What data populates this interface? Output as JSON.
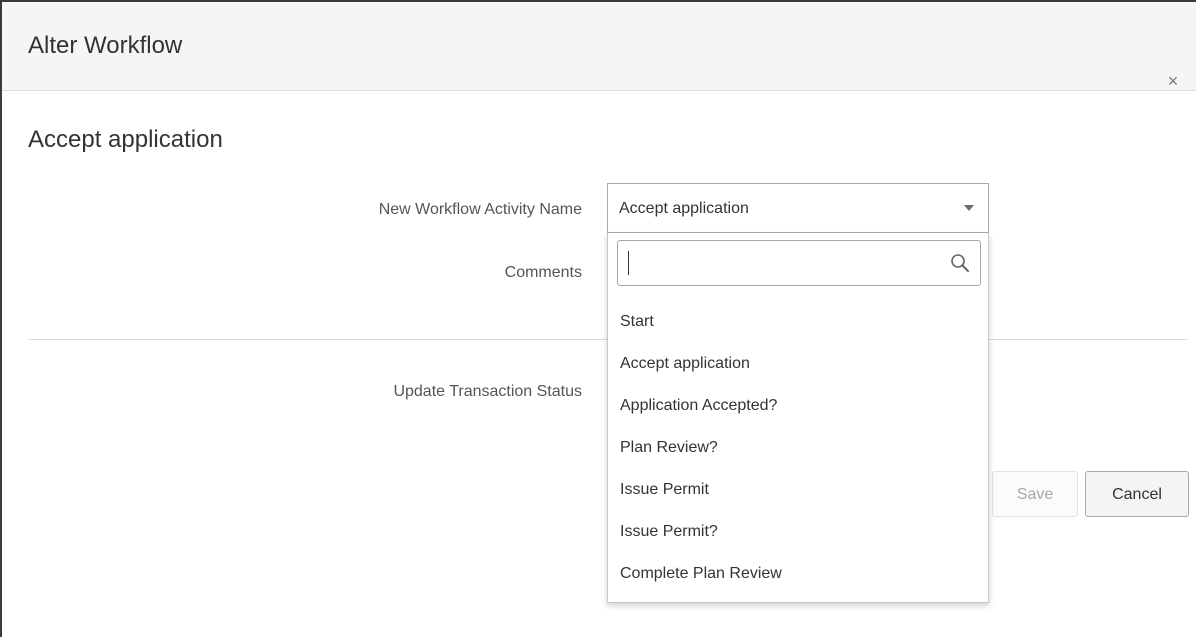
{
  "dialog": {
    "title": "Alter Workflow",
    "close_symbol": "×",
    "section_title": "Accept application"
  },
  "form": {
    "activity_label": "New Workflow Activity Name",
    "activity_value": "Accept application",
    "comments_label": "Comments",
    "status_label": "Update Transaction Status"
  },
  "dropdown": {
    "search_value": "",
    "options": [
      "Start",
      "Accept application",
      "Application Accepted?",
      "Plan Review?",
      "Issue Permit",
      "Issue Permit?",
      "Complete Plan Review"
    ]
  },
  "buttons": {
    "save_label": "Save",
    "cancel_label": "Cancel",
    "save_enabled": false
  },
  "icons": {
    "close": "close-icon",
    "caret": "chevron-down-icon",
    "search": "search-icon"
  }
}
